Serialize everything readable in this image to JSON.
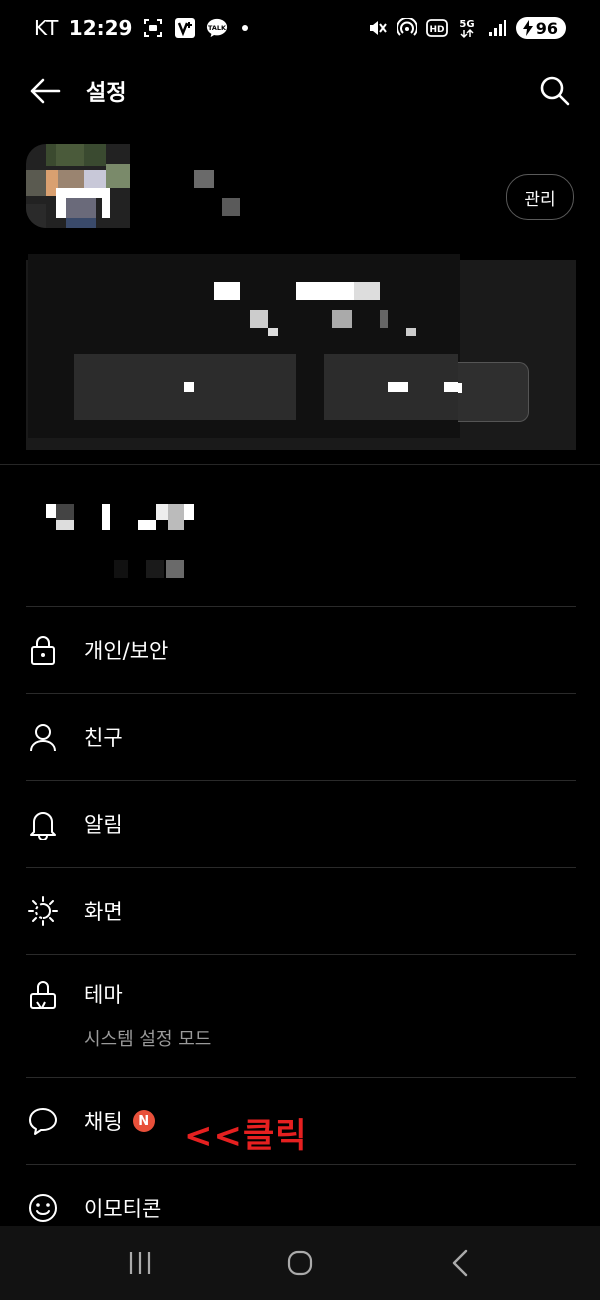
{
  "status_bar": {
    "carrier": "KT",
    "time": "12:29",
    "battery": "96",
    "icons": [
      "screenshot-icon",
      "vyn-app-icon",
      "kakaotalk-icon",
      "mute-icon",
      "hotspot-icon",
      "hd-voice-icon",
      "5g-icon",
      "signal-icon",
      "battery-icon"
    ],
    "talk_label": "TALK"
  },
  "app_bar": {
    "title": "설정"
  },
  "profile": {
    "manage_label": "관리"
  },
  "menu": {
    "items": [
      {
        "label": "개인/보안",
        "icon": "lock-icon"
      },
      {
        "label": "친구",
        "icon": "person-icon"
      },
      {
        "label": "알림",
        "icon": "bell-icon"
      },
      {
        "label": "화면",
        "icon": "display-brightness-icon"
      },
      {
        "label": "테마",
        "icon": "paint-brush-icon",
        "sub": "시스템 설정 모드"
      },
      {
        "label": "채팅",
        "icon": "chat-bubble-icon",
        "badge": "N"
      },
      {
        "label": "이모티콘",
        "icon": "emoticon-icon"
      }
    ]
  },
  "annotation": {
    "text": "<<클릭",
    "color": "#e62020"
  },
  "nav_bar": {
    "icons": [
      "recent-apps-icon",
      "home-icon",
      "back-nav-icon"
    ]
  },
  "colors": {
    "background": "#000000",
    "badge": "#e8503a"
  }
}
